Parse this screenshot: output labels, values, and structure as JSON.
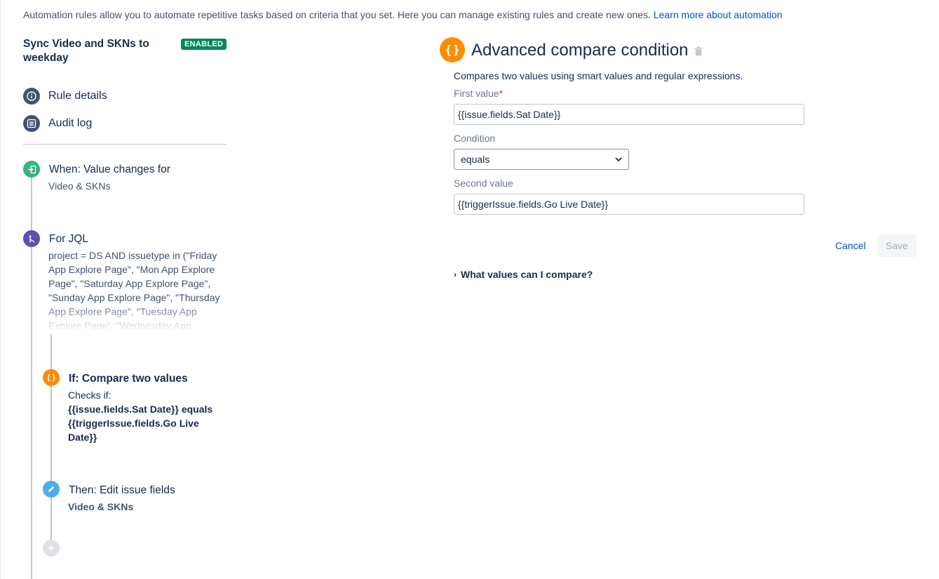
{
  "intro": {
    "text": "Automation rules allow you to automate repetitive tasks based on criteria that you set. Here you can manage existing rules and create new ones.",
    "link": "Learn more about automation"
  },
  "rule": {
    "title": "Sync Video and SKNs to weekday",
    "status": "ENABLED"
  },
  "nav": [
    {
      "label": "Rule details",
      "icon": "info-icon"
    },
    {
      "label": "Audit log",
      "icon": "list-icon"
    }
  ],
  "steps": {
    "trigger": {
      "title": "When: Value changes for",
      "subtitle": "Video & SKNs",
      "icon": "trigger-icon",
      "color": "#36b37e"
    },
    "branch": {
      "title": "For JQL",
      "jql": "project = DS AND issuetype in (\"Friday App Explore Page\", \"Mon App Explore Page\", \"Saturday App Explore Page\", \"Sunday App Explore Page\", \"Thursday App Explore Page\", \"Tuesday App Explore Page\", \"Wednesday App",
      "icon": "branch-icon",
      "color": "#5e4db2"
    },
    "condition": {
      "title": "If: Compare two values",
      "checks_label": "Checks if:",
      "expr_line1": "{{issue.fields.Sat Date}} equals",
      "expr_line2": "{{triggerIssue.fields.Go Live",
      "expr_line3": "Date}}",
      "icon": "braces-icon",
      "color": "#ff8b00"
    },
    "action": {
      "title": "Then: Edit issue fields",
      "subtitle": "Video & SKNs",
      "icon": "pencil-icon",
      "color": "#4baee8"
    }
  },
  "panel": {
    "icon_glyph": "{ }",
    "title": "Advanced compare condition",
    "description": "Compares two values using smart values and regular expressions.",
    "first_value_label": "First value",
    "required_mark": "*",
    "first_value": "{{issue.fields.Sat Date}}",
    "condition_label": "Condition",
    "condition_value": "equals",
    "second_value_label": "Second value",
    "second_value": "{{triggerIssue.fields.Go Live Date}}",
    "cancel_label": "Cancel",
    "save_label": "Save",
    "expander_label": "What values can I compare?"
  }
}
